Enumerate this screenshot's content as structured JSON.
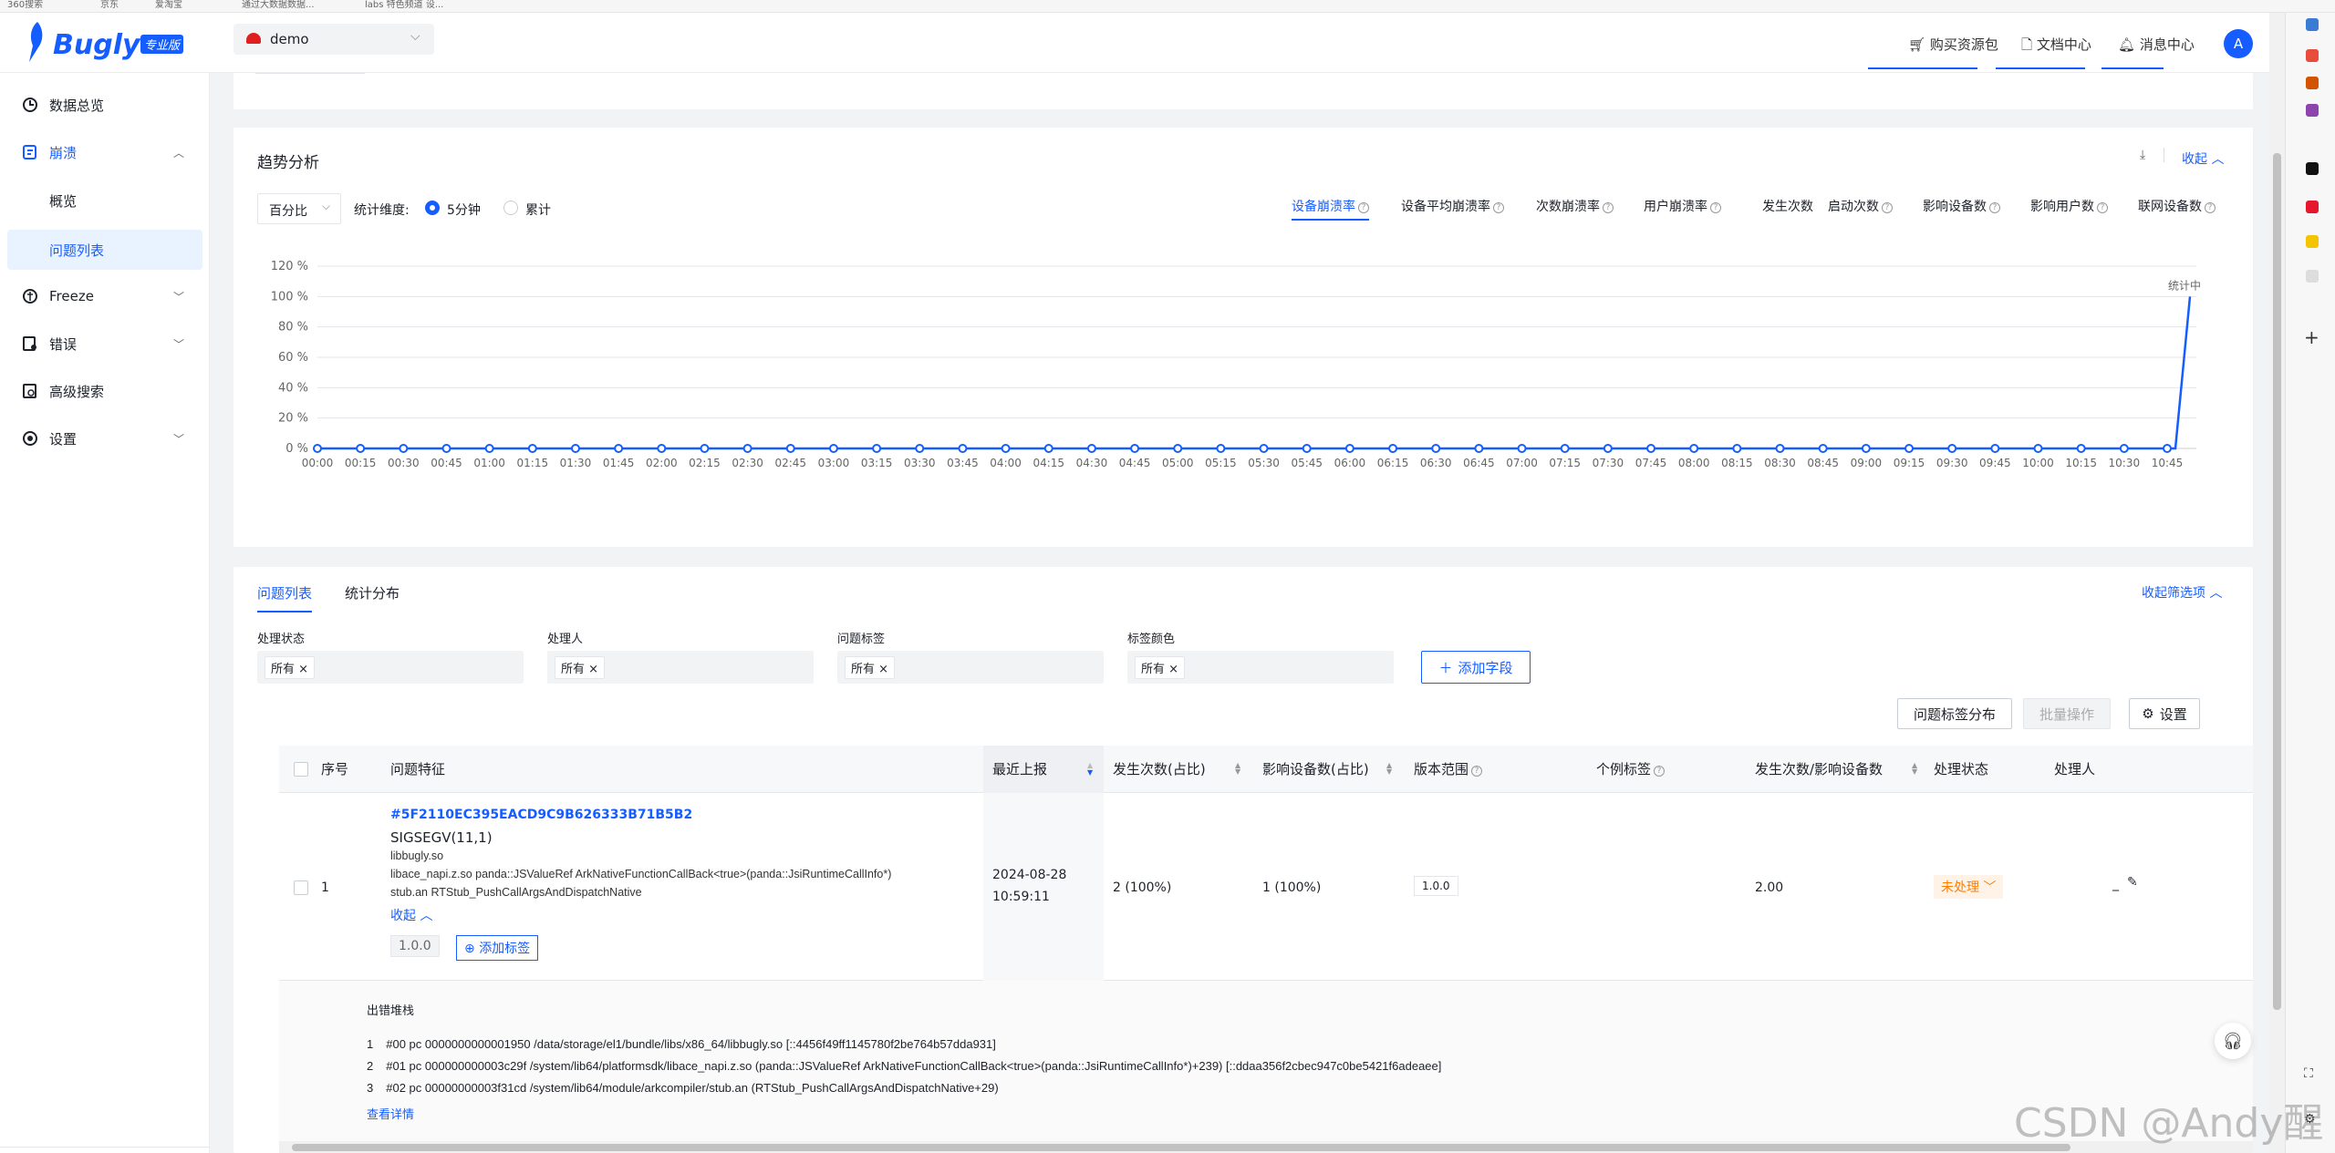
{
  "bookmarks": [
    "360搜索",
    "京东",
    "爱淘宝",
    "通过大数据数据...",
    "labs 特色频道 设..."
  ],
  "brand": {
    "name": "Bugly",
    "badge": "专业版"
  },
  "app_selector": {
    "value": "demo"
  },
  "header": {
    "buy": "购买资源包",
    "docs": "文档中心",
    "messages": "消息中心",
    "avatar": "A"
  },
  "sidebar": {
    "overview": "数据总览",
    "crash": "崩溃",
    "crash_sub_overview": "概览",
    "crash_sub_issues": "问题列表",
    "freeze": "Freeze",
    "error": "错误",
    "advanced_search": "高级搜索",
    "settings": "设置"
  },
  "trend": {
    "title": "趋势分析",
    "collapse": "收起",
    "mode": "百分比",
    "dimension_label": "统计维度:",
    "opt_5min": "5分钟",
    "opt_cumulative": "累计",
    "metrics": [
      "设备崩溃率",
      "设备平均崩溃率",
      "次数崩溃率",
      "用户崩溃率",
      "发生次数",
      "启动次数",
      "影响设备数",
      "影响用户数",
      "联网设备数"
    ],
    "metrics_help": [
      true,
      true,
      true,
      true,
      false,
      true,
      true,
      true,
      true
    ],
    "active_metric": "设备崩溃率"
  },
  "chart_data": {
    "type": "line",
    "ylabels": [
      "120 %",
      "100 %",
      "80 %",
      "60 %",
      "40 %",
      "20 %",
      "0 %"
    ],
    "ylim": [
      0,
      120
    ],
    "x": [
      "00:00",
      "00:15",
      "00:30",
      "00:45",
      "01:00",
      "01:15",
      "01:30",
      "01:45",
      "02:00",
      "02:15",
      "02:30",
      "02:45",
      "03:00",
      "03:15",
      "03:30",
      "03:45",
      "04:00",
      "04:15",
      "04:30",
      "04:45",
      "05:00",
      "05:15",
      "05:30",
      "05:45",
      "06:00",
      "06:15",
      "06:30",
      "06:45",
      "07:00",
      "07:15",
      "07:30",
      "07:45",
      "08:00",
      "08:15",
      "08:30",
      "08:45",
      "09:00",
      "09:15",
      "09:30",
      "09:45",
      "10:00",
      "10:15",
      "10:30",
      "10:45"
    ],
    "series": [
      {
        "values": [
          0,
          0,
          0,
          0,
          0,
          0,
          0,
          0,
          0,
          0,
          0,
          0,
          0,
          0,
          0,
          0,
          0,
          0,
          0,
          0,
          0,
          0,
          0,
          0,
          0,
          0,
          0,
          0,
          0,
          0,
          0,
          0,
          0,
          0,
          0,
          0,
          0,
          0,
          0,
          0,
          0,
          0,
          0,
          0
        ]
      }
    ],
    "last_point": {
      "label": "统计中",
      "value": 100
    },
    "color": "#165dff",
    "grid": true
  },
  "issues": {
    "tab_list": "问题列表",
    "tab_stats": "统计分布",
    "collapse_filters": "收起筛选项",
    "filters": [
      {
        "label": "处理状态",
        "value": "所有"
      },
      {
        "label": "处理人",
        "value": "所有"
      },
      {
        "label": "问题标签",
        "value": "所有"
      },
      {
        "label": "标签颜色",
        "value": "所有"
      }
    ],
    "add_field": "添加字段",
    "tag_dist": "问题标签分布",
    "batch": "批量操作",
    "settings": "设置",
    "columns": [
      "序号",
      "问题特征",
      "最近上报",
      "发生次数(占比)",
      "影响设备数(占比)",
      "版本范围",
      "个例标签",
      "发生次数/影响设备数",
      "处理状态",
      "处理人"
    ],
    "row": {
      "index": "1",
      "id": "#5F2110EC395EACD9C9B626333B71B5B2",
      "signal": "SIGSEGV(11,1)",
      "lines": [
        "libbugly.so",
        "libace_napi.z.so panda::JSValueRef ArkNativeFunctionCallBack<true>(panda::JsiRuntimeCallInfo*)",
        "stub.an RTStub_PushCallArgsAndDispatchNative"
      ],
      "collapse": "收起",
      "version_tag": "1.0.0",
      "add_tag": "添加标签",
      "date": "2024-08-28",
      "time": "10:59:11",
      "count": "2 (100%)",
      "devices": "1 (100%)",
      "version": "1.0.0",
      "ratio": "2.00",
      "status": "未处理",
      "assignee": "_"
    },
    "stack": {
      "title": "出错堆栈",
      "lines": [
        {
          "n": "1",
          "t": "#00 pc 0000000000001950 /data/storage/el1/bundle/libs/x86_64/libbugly.so [::4456f49ff1145780f2be764b57dda931]"
        },
        {
          "n": "2",
          "t": "#01 pc 000000000003c29f /system/lib64/platformsdk/libace_napi.z.so (panda::JSValueRef ArkNativeFunctionCallBack<true>(panda::JsiRuntimeCallInfo*)+239) [::ddaa356f2cbec947c0be5421f6adeaee]"
        },
        {
          "n": "3",
          "t": "#02 pc 00000000003f31cd /system/lib64/module/arkcompiler/stub.an (RTStub_PushCallArgsAndDispatchNative+29)"
        }
      ],
      "more": "查看详情"
    }
  },
  "watermark": "CSDN @Andy醒"
}
